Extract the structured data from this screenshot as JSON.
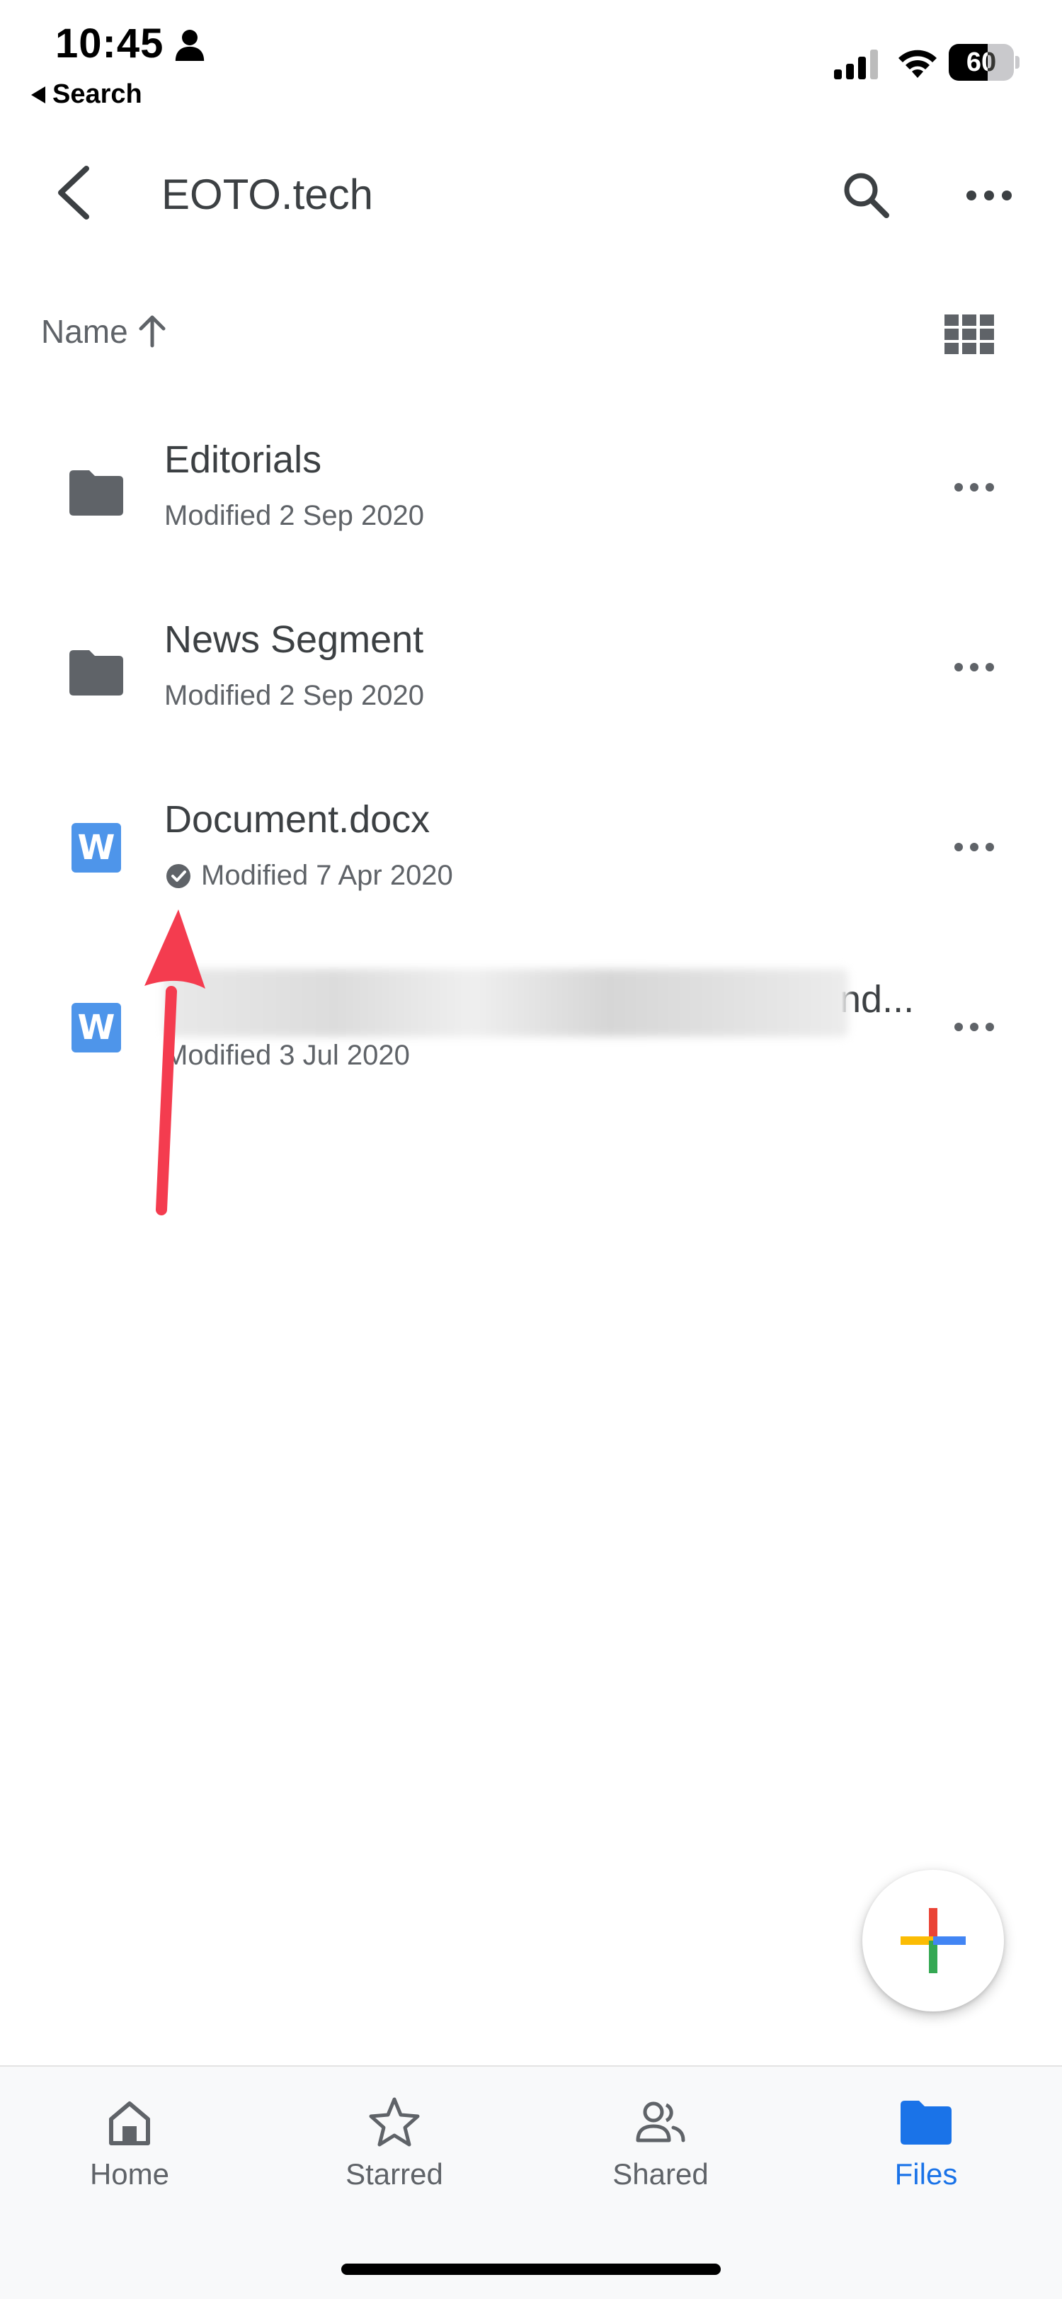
{
  "status_bar": {
    "time": "10:45",
    "back_label": "Search",
    "battery": "60",
    "battery_level": 0.6
  },
  "app_bar": {
    "title": "EOTO.tech",
    "icons": [
      "back-arrow-icon",
      "search-icon",
      "more-horiz-icon"
    ]
  },
  "sort": {
    "label": "Name",
    "direction_icon": "arrow-up-icon",
    "view_icon": "grid-view-icon"
  },
  "files": [
    {
      "type": "folder",
      "name": "Editorials",
      "modified": "Modified 2 Sep 2020",
      "offline": false
    },
    {
      "type": "folder",
      "name": "News Segment",
      "modified": "Modified 2 Sep 2020",
      "offline": false
    },
    {
      "type": "word",
      "name": "Document.docx",
      "modified": "Modified 7 Apr 2020",
      "offline": true
    },
    {
      "type": "word",
      "name": "nd...",
      "modified": "Modified 3 Jul 2020",
      "offline": false,
      "name_obscured": true
    }
  ],
  "word_icon_letter": "W",
  "fab": {
    "icon": "plus-icon",
    "colors": [
      "#ea4335",
      "#fbbc04",
      "#34a853",
      "#4285f4"
    ]
  },
  "bottom_nav": {
    "tabs": [
      {
        "label": "Home",
        "icon": "home-icon"
      },
      {
        "label": "Starred",
        "icon": "star-icon"
      },
      {
        "label": "Shared",
        "icon": "people-icon"
      },
      {
        "label": "Files",
        "icon": "folder-icon",
        "active": true
      }
    ]
  },
  "colors": {
    "accent": "#1a73e8",
    "annotation": "#f43c4f",
    "word_blue": "#4e95ea",
    "folder_grey": "#5f6368"
  }
}
